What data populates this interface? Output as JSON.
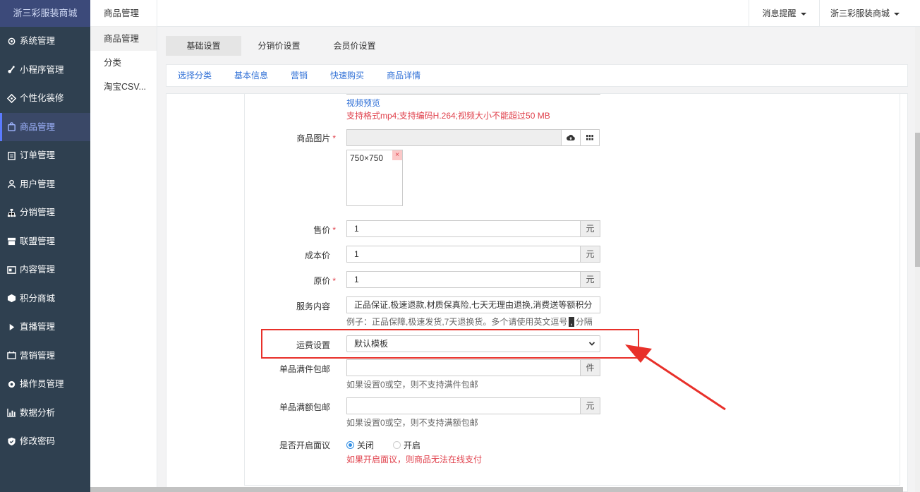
{
  "sidebar": {
    "brand": "浙三彩服装商城",
    "items": [
      {
        "label": "系统管理",
        "icon": "gear-icon"
      },
      {
        "label": "小程序管理",
        "icon": "link-icon"
      },
      {
        "label": "个性化装修",
        "icon": "diamond-icon"
      },
      {
        "label": "商品管理",
        "icon": "bag-icon",
        "active": true
      },
      {
        "label": "订单管理",
        "icon": "clipboard-icon"
      },
      {
        "label": "用户管理",
        "icon": "user-icon"
      },
      {
        "label": "分销管理",
        "icon": "sitemap-icon"
      },
      {
        "label": "联盟管理",
        "icon": "store-icon"
      },
      {
        "label": "内容管理",
        "icon": "content-icon"
      },
      {
        "label": "积分商城",
        "icon": "cube-icon"
      },
      {
        "label": "直播管理",
        "icon": "play-icon"
      },
      {
        "label": "营销管理",
        "icon": "marketing-icon"
      },
      {
        "label": "操作员管理",
        "icon": "cog-icon"
      },
      {
        "label": "数据分析",
        "icon": "bar-chart-icon"
      },
      {
        "label": "修改密码",
        "icon": "shield-icon"
      }
    ]
  },
  "subbar": {
    "title": "商品管理",
    "items": [
      "商品管理",
      "分类",
      "淘宝CSV..."
    ]
  },
  "topbar": {
    "notifications": "消息提醒",
    "store": "浙三彩服装商城"
  },
  "tabs": [
    "基础设置",
    "分销价设置",
    "会员价设置"
  ],
  "subtabs": [
    "选择分类",
    "基本信息",
    "营销",
    "快速购买",
    "商品详情"
  ],
  "form": {
    "video_preview": "视频预览",
    "video_hint": "支持格式mp4;支持编码H.264;视频大小不能超过50 MB",
    "image_label": "商品图片",
    "image_size": "750×750",
    "price_label": "售价",
    "price_value": "1",
    "cost_label": "成本价",
    "cost_value": "1",
    "original_label": "原价",
    "original_value": "1",
    "unit_yuan": "元",
    "unit_jian": "件",
    "service_label": "服务内容",
    "service_value": "正品保证,极速退款,材质保真险,七天无理由退换,消费送等额积分",
    "service_hint_a": "例子：正品保障,极速发货,7天退换货。多个请使用英文逗号",
    "service_hint_comma": ",",
    "service_hint_b": "分隔",
    "shipping_label": "运费设置",
    "shipping_value": "默认模板",
    "free_count_label": "单品满件包邮",
    "free_count_hint": "如果设置0或空，则不支持满件包邮",
    "free_amount_label": "单品满额包邮",
    "free_amount_hint": "如果设置0或空，则不支持满额包邮",
    "negotiable_label": "是否开启面议",
    "radio_off": "关闭",
    "radio_on": "开启",
    "negotiable_hint": "如果开启面议，则商品无法在线支付"
  },
  "colors": {
    "sidebar_bg": "#2f4050",
    "accent": "#2f6fd6",
    "highlight": "#e8302a"
  }
}
